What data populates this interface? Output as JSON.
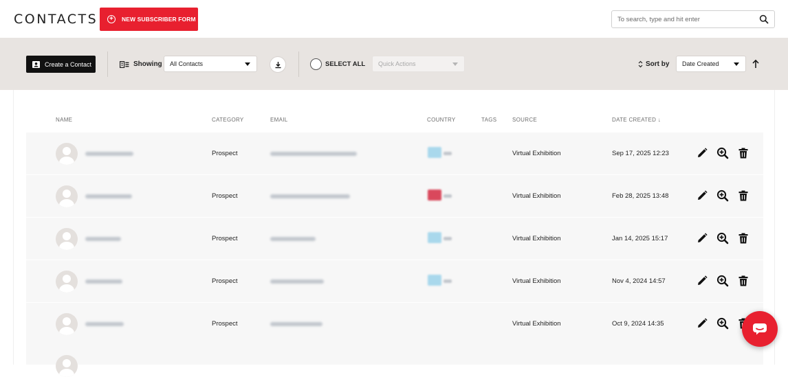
{
  "header": {
    "title": "CONTACTS",
    "new_form_label": "NEW SUBSCRIBER FORM",
    "search_placeholder": "To search, type and hit enter",
    "search_value": ""
  },
  "toolbar": {
    "create_label": "Create a Contact",
    "showing_label": "Showing",
    "showing_value": "All Contacts",
    "select_all_label": "SELECT ALL",
    "quick_actions_placeholder": "Quick Actions",
    "sort_label": "Sort by",
    "sort_value": "Date Created",
    "sort_direction": "ascending"
  },
  "table": {
    "columns": {
      "name": "NAME",
      "category": "CATEGORY",
      "email": "EMAIL",
      "country": "COUNTRY",
      "tags": "TAGS",
      "source": "SOURCE",
      "date_created": "DATE CREATED ↓"
    },
    "rows": [
      {
        "category": "Prospect",
        "source": "Virtual Exhibition",
        "date_created": "Sep 17, 2025 12:23",
        "has_flag": true,
        "flag_color": "#a9d8ec"
      },
      {
        "category": "Prospect",
        "source": "Virtual Exhibition",
        "date_created": "Feb 28, 2025 13:48",
        "has_flag": true,
        "flag_color": "#d9485c"
      },
      {
        "category": "Prospect",
        "source": "Virtual Exhibition",
        "date_created": "Jan 14, 2025 15:17",
        "has_flag": true,
        "flag_color": "#a9d8ec"
      },
      {
        "category": "Prospect",
        "source": "Virtual Exhibition",
        "date_created": "Nov 4, 2024 14:57",
        "has_flag": true,
        "flag_color": "#a9d8ec"
      },
      {
        "category": "Prospect",
        "source": "Virtual Exhibition",
        "date_created": "Oct 9, 2024 14:35",
        "has_flag": false,
        "flag_color": ""
      }
    ]
  },
  "colors": {
    "brand_red": "#e8202f",
    "toolbar_bg": "#e8e4e1",
    "row_bg": "#f7f7f7"
  },
  "icons": [
    "plus-circle-icon",
    "search-icon",
    "contact-card-icon",
    "list-view-icon",
    "download-icon",
    "sort-icon",
    "arrow-up-icon",
    "edit-icon",
    "zoom-in-icon",
    "trash-icon",
    "chat-icon",
    "avatar-icon"
  ]
}
